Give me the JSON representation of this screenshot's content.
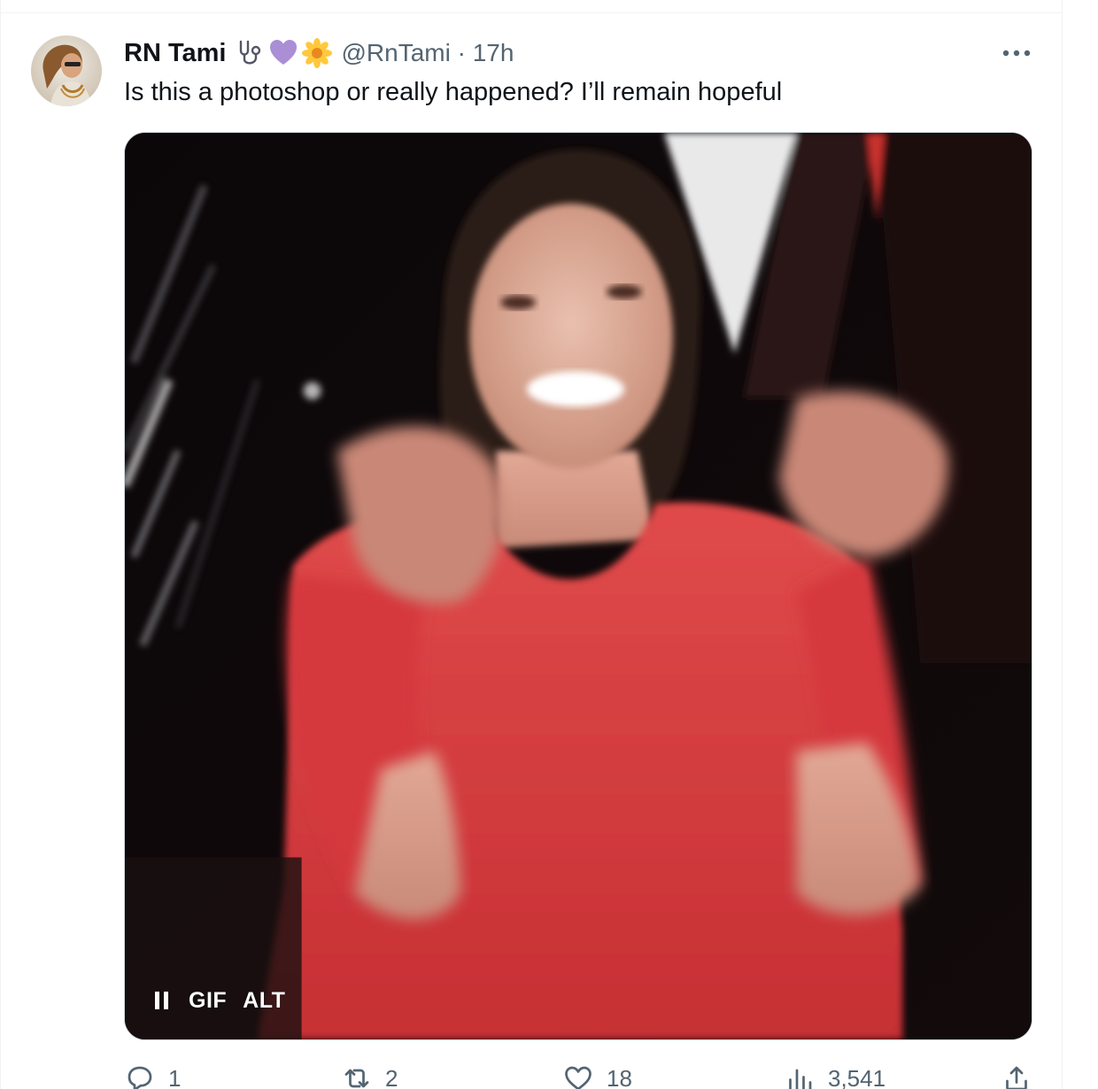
{
  "tweet": {
    "author": {
      "display_name": "RN Tami",
      "handle": "@RnTami",
      "separator": "·",
      "time": "17h",
      "emojis": [
        "stethoscope-emoji",
        "purple-heart-emoji",
        "blossom-emoji"
      ]
    },
    "text": "Is this a photoshop or really happened? I’ll remain hopeful",
    "media": {
      "type_label": "GIF",
      "alt_label": "ALT"
    },
    "actions": {
      "replies": "1",
      "reposts": "2",
      "likes": "18",
      "views": "3,541"
    }
  },
  "colors": {
    "text_primary": "#0f1419",
    "text_secondary": "#536471",
    "border": "#cfd9de",
    "divider": "#eff3f4"
  }
}
